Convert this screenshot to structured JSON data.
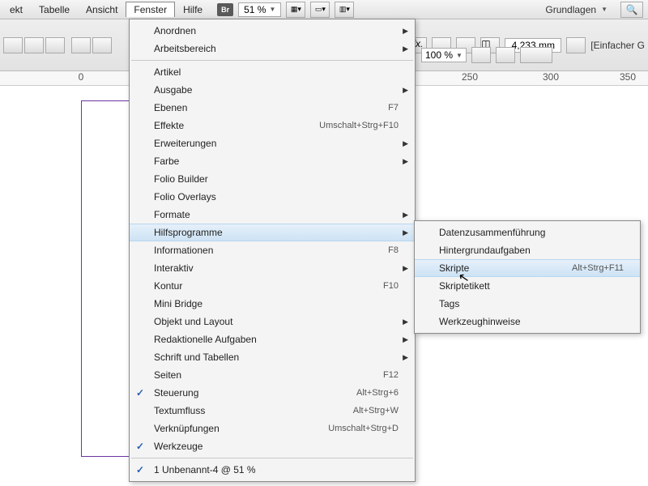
{
  "menubar": {
    "items": [
      "ekt",
      "Tabelle",
      "Ansicht",
      "Fenster",
      "Hilfe"
    ],
    "bridge_label": "Br",
    "zoom": "51 %",
    "workspace": "Grundlagen"
  },
  "toolbar": {
    "measurement": "4,233 mm",
    "percent": "100 %",
    "sample_label": "[Einfacher G"
  },
  "ruler": {
    "ticks": [
      "0",
      "250",
      "300",
      "350"
    ]
  },
  "menu": {
    "items": [
      {
        "label": "Anordnen",
        "submenu": true
      },
      {
        "label": "Arbeitsbereich",
        "submenu": true
      },
      {
        "sep": true
      },
      {
        "label": "Artikel"
      },
      {
        "label": "Ausgabe",
        "submenu": true
      },
      {
        "label": "Ebenen",
        "shortcut": "F7"
      },
      {
        "label": "Effekte",
        "shortcut": "Umschalt+Strg+F10"
      },
      {
        "label": "Erweiterungen",
        "submenu": true
      },
      {
        "label": "Farbe",
        "submenu": true
      },
      {
        "label": "Folio Builder"
      },
      {
        "label": "Folio Overlays"
      },
      {
        "label": "Formate",
        "submenu": true
      },
      {
        "label": "Hilfsprogramme",
        "submenu": true,
        "highlight": true
      },
      {
        "label": "Informationen",
        "shortcut": "F8"
      },
      {
        "label": "Interaktiv",
        "submenu": true
      },
      {
        "label": "Kontur",
        "shortcut": "F10"
      },
      {
        "label": "Mini Bridge"
      },
      {
        "label": "Objekt und Layout",
        "submenu": true
      },
      {
        "label": "Redaktionelle Aufgaben",
        "submenu": true
      },
      {
        "label": "Schrift und Tabellen",
        "submenu": true
      },
      {
        "label": "Seiten",
        "shortcut": "F12"
      },
      {
        "label": "Steuerung",
        "shortcut": "Alt+Strg+6",
        "checked": true
      },
      {
        "label": "Textumfluss",
        "shortcut": "Alt+Strg+W"
      },
      {
        "label": "Verknüpfungen",
        "shortcut": "Umschalt+Strg+D"
      },
      {
        "label": "Werkzeuge",
        "checked": true
      },
      {
        "sep": true
      },
      {
        "label": "1 Unbenannt-4 @ 51 %",
        "checked": true
      }
    ]
  },
  "submenu": {
    "items": [
      {
        "label": "Datenzusammenführung"
      },
      {
        "label": "Hintergrundaufgaben"
      },
      {
        "label": "Skripte",
        "shortcut": "Alt+Strg+F11",
        "highlight": true
      },
      {
        "label": "Skriptetikett"
      },
      {
        "label": "Tags"
      },
      {
        "label": "Werkzeughinweise"
      }
    ]
  }
}
